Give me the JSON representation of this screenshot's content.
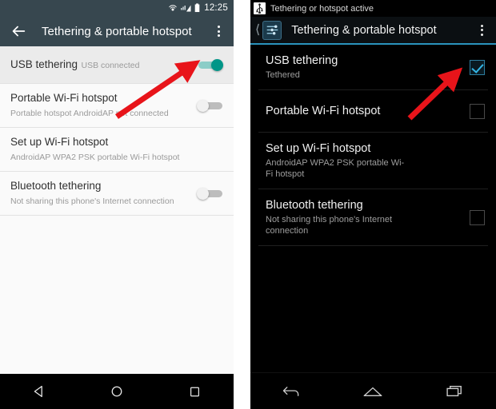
{
  "left_phone": {
    "status_bar": {
      "clock": "12:25",
      "icons": [
        "hotspot-icon",
        "signal-icon",
        "battery-icon"
      ]
    },
    "app_bar": {
      "back_icon": "back-arrow-icon",
      "title": "Tethering & portable hotspot",
      "overflow_icon": "overflow-menu-icon"
    },
    "items": [
      {
        "title": "USB tethering",
        "subtitle": "USB connected",
        "control": "switch",
        "state": "on",
        "selected": true
      },
      {
        "title": "Portable Wi-Fi hotspot",
        "subtitle": "Portable hotspot AndroidAP not connected",
        "control": "switch",
        "state": "off",
        "selected": false
      },
      {
        "title": "Set up Wi-Fi hotspot",
        "subtitle": "AndroidAP WPA2 PSK portable Wi-Fi hotspot",
        "control": "none",
        "state": "",
        "selected": false
      },
      {
        "title": "Bluetooth tethering",
        "subtitle": "Not sharing this phone's Internet connection",
        "control": "switch",
        "state": "off",
        "selected": false
      }
    ],
    "nav_bar": {
      "back_icon": "nav-back-triangle-icon",
      "home_icon": "nav-home-circle-icon",
      "recents_icon": "nav-recents-square-icon"
    }
  },
  "right_phone": {
    "status_bar": {
      "usb_icon": "usb-tethering-icon",
      "notification_text": "Tethering or hotspot active"
    },
    "app_bar": {
      "back_icon": "back-chevron-icon",
      "app_icon": "settings-sliders-icon",
      "title": "Tethering & portable hotspot",
      "overflow_icon": "overflow-menu-icon"
    },
    "items": [
      {
        "title": "USB tethering",
        "subtitle": "Tethered",
        "control": "checkbox",
        "state": "checked"
      },
      {
        "title": "Portable Wi-Fi hotspot",
        "subtitle": "",
        "control": "checkbox",
        "state": "unchecked"
      },
      {
        "title": "Set up Wi-Fi hotspot",
        "subtitle": "AndroidAP WPA2 PSK portable Wi-Fi hotspot",
        "control": "none",
        "state": ""
      },
      {
        "title": "Bluetooth tethering",
        "subtitle": "Not sharing this phone's Internet connection",
        "control": "checkbox",
        "state": "unchecked"
      }
    ],
    "nav_bar": {
      "back_icon": "nav-back-arrow-icon",
      "home_icon": "nav-home-icon",
      "recents_icon": "nav-recents-icon"
    }
  },
  "annotations": {
    "arrow_color": "#e8141a",
    "left_arrow": "points-to-usb-tethering-switch",
    "right_arrow": "points-to-usb-tethering-checkbox"
  },
  "colors": {
    "left_appbar": "#37474f",
    "left_background": "#fafafa",
    "switch_on": "#009688",
    "right_background": "#000000",
    "holo_blue": "#33b5e5",
    "arrow_red": "#e8141a"
  }
}
